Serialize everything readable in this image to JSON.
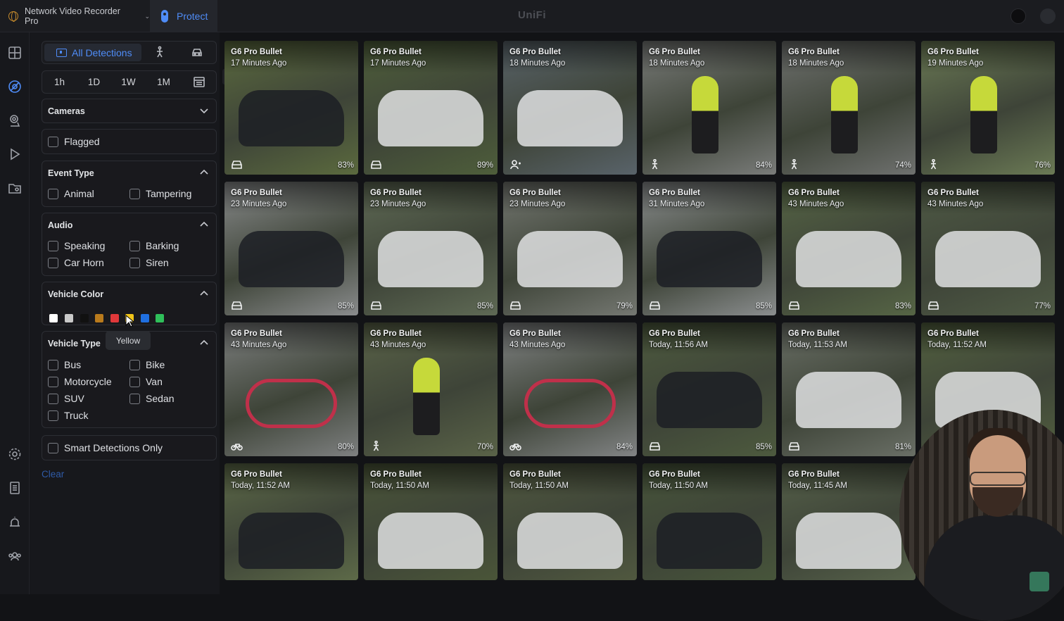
{
  "console": {
    "name": "Network Video Recorder Pro"
  },
  "app": {
    "name": "Protect",
    "brand": "UniFi"
  },
  "filters": {
    "detection_tab": "All Detections",
    "time_ranges": [
      "1h",
      "1D",
      "1W",
      "1M"
    ],
    "cameras_label": "Cameras",
    "flagged_label": "Flagged",
    "event_type": {
      "title": "Event Type",
      "options": [
        "Animal",
        "Tampering"
      ]
    },
    "audio": {
      "title": "Audio",
      "options": [
        "Speaking",
        "Barking",
        "Car Horn",
        "Siren"
      ]
    },
    "vehicle_color": {
      "title": "Vehicle Color",
      "colors": [
        "#ffffff",
        "#c9c9c9",
        "#111111",
        "#b97a1c",
        "#e0383a",
        "#f0c419",
        "#1f6fe0",
        "#2fbf5a"
      ],
      "hovered_tooltip": "Yellow"
    },
    "vehicle_type": {
      "title": "Vehicle Type",
      "options": [
        "Bus",
        "Bike",
        "Motorcycle",
        "Van",
        "SUV",
        "Sedan",
        "Truck"
      ]
    },
    "smart_only_label": "Smart Detections Only",
    "clear_label": "Clear"
  },
  "detections": [
    {
      "camera": "G6 Pro Bullet",
      "time": "17 Minutes Ago",
      "confidence": "83%",
      "type": "vehicle",
      "bg": "#5b6a3e"
    },
    {
      "camera": "G6 Pro Bullet",
      "time": "17 Minutes Ago",
      "confidence": "89%",
      "type": "vehicle",
      "bg": "#4e5e3a"
    },
    {
      "camera": "G6 Pro Bullet",
      "time": "18 Minutes Ago",
      "confidence": "",
      "type": "face",
      "bg": "#59636a"
    },
    {
      "camera": "G6 Pro Bullet",
      "time": "18 Minutes Ago",
      "confidence": "84%",
      "type": "person",
      "bg": "#7a7c7a"
    },
    {
      "camera": "G6 Pro Bullet",
      "time": "18 Minutes Ago",
      "confidence": "74%",
      "type": "person",
      "bg": "#6f716f"
    },
    {
      "camera": "G6 Pro Bullet",
      "time": "19 Minutes Ago",
      "confidence": "76%",
      "type": "person",
      "bg": "#6b7a55"
    },
    {
      "camera": "G6 Pro Bullet",
      "time": "23 Minutes Ago",
      "confidence": "85%",
      "type": "vehicle",
      "bg": "#8a8c8d"
    },
    {
      "camera": "G6 Pro Bullet",
      "time": "23 Minutes Ago",
      "confidence": "85%",
      "type": "vehicle",
      "bg": "#5f6a55"
    },
    {
      "camera": "G6 Pro Bullet",
      "time": "23 Minutes Ago",
      "confidence": "79%",
      "type": "vehicle",
      "bg": "#757872"
    },
    {
      "camera": "G6 Pro Bullet",
      "time": "31 Minutes Ago",
      "confidence": "85%",
      "type": "vehicle",
      "bg": "#8b8e8f"
    },
    {
      "camera": "G6 Pro Bullet",
      "time": "43 Minutes Ago",
      "confidence": "83%",
      "type": "vehicle",
      "bg": "#566545"
    },
    {
      "camera": "G6 Pro Bullet",
      "time": "43 Minutes Ago",
      "confidence": "77%",
      "type": "vehicle",
      "bg": "#4f5a45"
    },
    {
      "camera": "G6 Pro Bullet",
      "time": "43 Minutes Ago",
      "confidence": "80%",
      "type": "bike",
      "bg": "#7e8080"
    },
    {
      "camera": "G6 Pro Bullet",
      "time": "43 Minutes Ago",
      "confidence": "70%",
      "type": "person",
      "bg": "#5a6348"
    },
    {
      "camera": "G6 Pro Bullet",
      "time": "43 Minutes Ago",
      "confidence": "84%",
      "type": "bike",
      "bg": "#828485"
    },
    {
      "camera": "G6 Pro Bullet",
      "time": "Today, 11:56 AM",
      "confidence": "85%",
      "type": "vehicle",
      "bg": "#4d5a3e"
    },
    {
      "camera": "G6 Pro Bullet",
      "time": "Today, 11:53 AM",
      "confidence": "81%",
      "type": "vehicle",
      "bg": "#6a6f66"
    },
    {
      "camera": "G6 Pro Bullet",
      "time": "Today, 11:52 AM",
      "confidence": "",
      "type": "vehicle",
      "bg": "#52603f"
    },
    {
      "camera": "G6 Pro Bullet",
      "time": "Today, 11:52 AM",
      "confidence": "",
      "type": "vehicle",
      "bg": "#5d6a48"
    },
    {
      "camera": "G6 Pro Bullet",
      "time": "Today, 11:50 AM",
      "confidence": "",
      "type": "vehicle",
      "bg": "#4a5538"
    },
    {
      "camera": "G6 Pro Bullet",
      "time": "Today, 11:50 AM",
      "confidence": "",
      "type": "vehicle",
      "bg": "#50583f"
    },
    {
      "camera": "G6 Pro Bullet",
      "time": "Today, 11:50 AM",
      "confidence": "",
      "type": "vehicle",
      "bg": "#47553a"
    },
    {
      "camera": "G6 Pro Bullet",
      "time": "Today, 11:45 AM",
      "confidence": "",
      "type": "vehicle",
      "bg": "#56614a"
    }
  ]
}
